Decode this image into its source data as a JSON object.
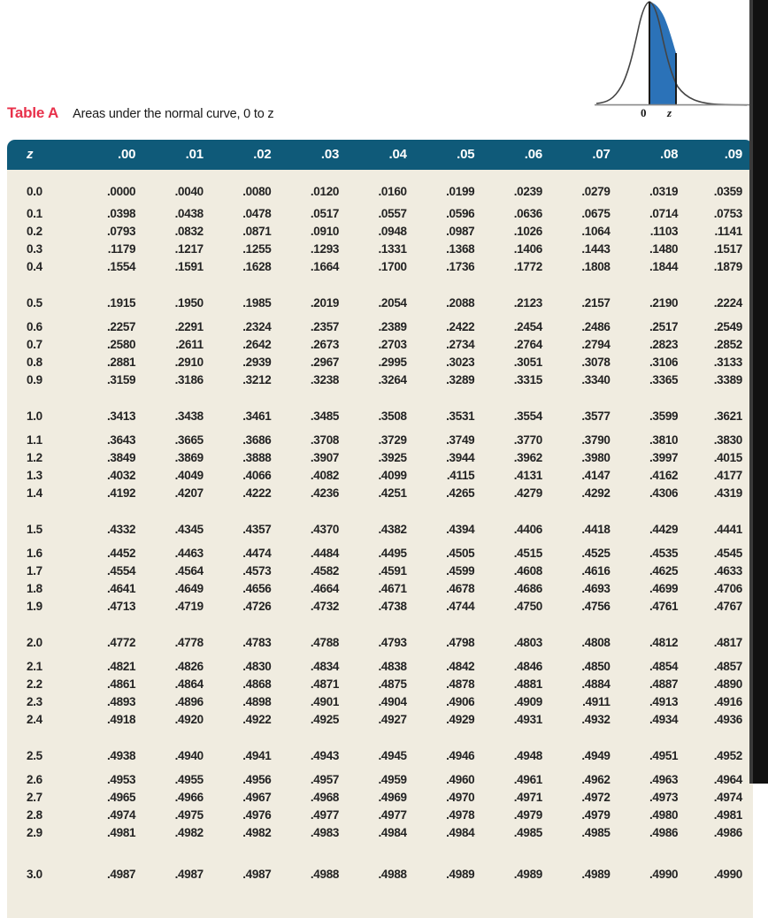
{
  "caption": {
    "label": "Table A",
    "text": "Areas under the normal curve, 0 to z"
  },
  "figure": {
    "name": "normal-curve-diagram",
    "axis_label_zero": "0",
    "axis_label_z": "z",
    "shade_color": "#2b72b8",
    "curve_color": "#444444"
  },
  "colors": {
    "header_background": "#0f5a79",
    "header_text": "#ffffff",
    "body_background": "#f0ece0",
    "body_text": "#232323",
    "caption_accent": "#e8304a",
    "page_background": "#ffffff",
    "page_edge": "#111111"
  },
  "table": {
    "columns": [
      "z",
      ".00",
      ".01",
      ".02",
      ".03",
      ".04",
      ".05",
      ".06",
      ".07",
      ".08",
      ".09"
    ],
    "group_size": 5,
    "rows": [
      [
        "0.0",
        ".0000",
        ".0040",
        ".0080",
        ".0120",
        ".0160",
        ".0199",
        ".0239",
        ".0279",
        ".0319",
        ".0359"
      ],
      [
        "0.1",
        ".0398",
        ".0438",
        ".0478",
        ".0517",
        ".0557",
        ".0596",
        ".0636",
        ".0675",
        ".0714",
        ".0753"
      ],
      [
        "0.2",
        ".0793",
        ".0832",
        ".0871",
        ".0910",
        ".0948",
        ".0987",
        ".1026",
        ".1064",
        ".1103",
        ".1141"
      ],
      [
        "0.3",
        ".1179",
        ".1217",
        ".1255",
        ".1293",
        ".1331",
        ".1368",
        ".1406",
        ".1443",
        ".1480",
        ".1517"
      ],
      [
        "0.4",
        ".1554",
        ".1591",
        ".1628",
        ".1664",
        ".1700",
        ".1736",
        ".1772",
        ".1808",
        ".1844",
        ".1879"
      ],
      [
        "0.5",
        ".1915",
        ".1950",
        ".1985",
        ".2019",
        ".2054",
        ".2088",
        ".2123",
        ".2157",
        ".2190",
        ".2224"
      ],
      [
        "0.6",
        ".2257",
        ".2291",
        ".2324",
        ".2357",
        ".2389",
        ".2422",
        ".2454",
        ".2486",
        ".2517",
        ".2549"
      ],
      [
        "0.7",
        ".2580",
        ".2611",
        ".2642",
        ".2673",
        ".2703",
        ".2734",
        ".2764",
        ".2794",
        ".2823",
        ".2852"
      ],
      [
        "0.8",
        ".2881",
        ".2910",
        ".2939",
        ".2967",
        ".2995",
        ".3023",
        ".3051",
        ".3078",
        ".3106",
        ".3133"
      ],
      [
        "0.9",
        ".3159",
        ".3186",
        ".3212",
        ".3238",
        ".3264",
        ".3289",
        ".3315",
        ".3340",
        ".3365",
        ".3389"
      ],
      [
        "1.0",
        ".3413",
        ".3438",
        ".3461",
        ".3485",
        ".3508",
        ".3531",
        ".3554",
        ".3577",
        ".3599",
        ".3621"
      ],
      [
        "1.1",
        ".3643",
        ".3665",
        ".3686",
        ".3708",
        ".3729",
        ".3749",
        ".3770",
        ".3790",
        ".3810",
        ".3830"
      ],
      [
        "1.2",
        ".3849",
        ".3869",
        ".3888",
        ".3907",
        ".3925",
        ".3944",
        ".3962",
        ".3980",
        ".3997",
        ".4015"
      ],
      [
        "1.3",
        ".4032",
        ".4049",
        ".4066",
        ".4082",
        ".4099",
        ".4115",
        ".4131",
        ".4147",
        ".4162",
        ".4177"
      ],
      [
        "1.4",
        ".4192",
        ".4207",
        ".4222",
        ".4236",
        ".4251",
        ".4265",
        ".4279",
        ".4292",
        ".4306",
        ".4319"
      ],
      [
        "1.5",
        ".4332",
        ".4345",
        ".4357",
        ".4370",
        ".4382",
        ".4394",
        ".4406",
        ".4418",
        ".4429",
        ".4441"
      ],
      [
        "1.6",
        ".4452",
        ".4463",
        ".4474",
        ".4484",
        ".4495",
        ".4505",
        ".4515",
        ".4525",
        ".4535",
        ".4545"
      ],
      [
        "1.7",
        ".4554",
        ".4564",
        ".4573",
        ".4582",
        ".4591",
        ".4599",
        ".4608",
        ".4616",
        ".4625",
        ".4633"
      ],
      [
        "1.8",
        ".4641",
        ".4649",
        ".4656",
        ".4664",
        ".4671",
        ".4678",
        ".4686",
        ".4693",
        ".4699",
        ".4706"
      ],
      [
        "1.9",
        ".4713",
        ".4719",
        ".4726",
        ".4732",
        ".4738",
        ".4744",
        ".4750",
        ".4756",
        ".4761",
        ".4767"
      ],
      [
        "2.0",
        ".4772",
        ".4778",
        ".4783",
        ".4788",
        ".4793",
        ".4798",
        ".4803",
        ".4808",
        ".4812",
        ".4817"
      ],
      [
        "2.1",
        ".4821",
        ".4826",
        ".4830",
        ".4834",
        ".4838",
        ".4842",
        ".4846",
        ".4850",
        ".4854",
        ".4857"
      ],
      [
        "2.2",
        ".4861",
        ".4864",
        ".4868",
        ".4871",
        ".4875",
        ".4878",
        ".4881",
        ".4884",
        ".4887",
        ".4890"
      ],
      [
        "2.3",
        ".4893",
        ".4896",
        ".4898",
        ".4901",
        ".4904",
        ".4906",
        ".4909",
        ".4911",
        ".4913",
        ".4916"
      ],
      [
        "2.4",
        ".4918",
        ".4920",
        ".4922",
        ".4925",
        ".4927",
        ".4929",
        ".4931",
        ".4932",
        ".4934",
        ".4936"
      ],
      [
        "2.5",
        ".4938",
        ".4940",
        ".4941",
        ".4943",
        ".4945",
        ".4946",
        ".4948",
        ".4949",
        ".4951",
        ".4952"
      ],
      [
        "2.6",
        ".4953",
        ".4955",
        ".4956",
        ".4957",
        ".4959",
        ".4960",
        ".4961",
        ".4962",
        ".4963",
        ".4964"
      ],
      [
        "2.7",
        ".4965",
        ".4966",
        ".4967",
        ".4968",
        ".4969",
        ".4970",
        ".4971",
        ".4972",
        ".4973",
        ".4974"
      ],
      [
        "2.8",
        ".4974",
        ".4975",
        ".4976",
        ".4977",
        ".4977",
        ".4978",
        ".4979",
        ".4979",
        ".4980",
        ".4981"
      ],
      [
        "2.9",
        ".4981",
        ".4982",
        ".4982",
        ".4983",
        ".4984",
        ".4984",
        ".4985",
        ".4985",
        ".4986",
        ".4986"
      ],
      [
        "3.0",
        ".4987",
        ".4987",
        ".4987",
        ".4988",
        ".4988",
        ".4989",
        ".4989",
        ".4989",
        ".4990",
        ".4990"
      ]
    ]
  },
  "chart_data": {
    "type": "table",
    "title": "Areas under the normal curve, 0 to z",
    "xlabel": "z",
    "ylabel": "Area",
    "description": "Standard normal cumulative area from 0 to z",
    "row_index": [
      "0.0",
      "0.1",
      "0.2",
      "0.3",
      "0.4",
      "0.5",
      "0.6",
      "0.7",
      "0.8",
      "0.9",
      "1.0",
      "1.1",
      "1.2",
      "1.3",
      "1.4",
      "1.5",
      "1.6",
      "1.7",
      "1.8",
      "1.9",
      "2.0",
      "2.1",
      "2.2",
      "2.3",
      "2.4",
      "2.5",
      "2.6",
      "2.7",
      "2.8",
      "2.9",
      "3.0"
    ],
    "column_offsets": [
      ".00",
      ".01",
      ".02",
      ".03",
      ".04",
      ".05",
      ".06",
      ".07",
      ".08",
      ".09"
    ],
    "values": [
      [
        0.0,
        0.004,
        0.008,
        0.012,
        0.016,
        0.0199,
        0.0239,
        0.0279,
        0.0319,
        0.0359
      ],
      [
        0.0398,
        0.0438,
        0.0478,
        0.0517,
        0.0557,
        0.0596,
        0.0636,
        0.0675,
        0.0714,
        0.0753
      ],
      [
        0.0793,
        0.0832,
        0.0871,
        0.091,
        0.0948,
        0.0987,
        0.1026,
        0.1064,
        0.1103,
        0.1141
      ],
      [
        0.1179,
        0.1217,
        0.1255,
        0.1293,
        0.1331,
        0.1368,
        0.1406,
        0.1443,
        0.148,
        0.1517
      ],
      [
        0.1554,
        0.1591,
        0.1628,
        0.1664,
        0.17,
        0.1736,
        0.1772,
        0.1808,
        0.1844,
        0.1879
      ],
      [
        0.1915,
        0.195,
        0.1985,
        0.2019,
        0.2054,
        0.2088,
        0.2123,
        0.2157,
        0.219,
        0.2224
      ],
      [
        0.2257,
        0.2291,
        0.2324,
        0.2357,
        0.2389,
        0.2422,
        0.2454,
        0.2486,
        0.2517,
        0.2549
      ],
      [
        0.258,
        0.2611,
        0.2642,
        0.2673,
        0.2703,
        0.2734,
        0.2764,
        0.2794,
        0.2823,
        0.2852
      ],
      [
        0.2881,
        0.291,
        0.2939,
        0.2967,
        0.2995,
        0.3023,
        0.3051,
        0.3078,
        0.3106,
        0.3133
      ],
      [
        0.3159,
        0.3186,
        0.3212,
        0.3238,
        0.3264,
        0.3289,
        0.3315,
        0.334,
        0.3365,
        0.3389
      ],
      [
        0.3413,
        0.3438,
        0.3461,
        0.3485,
        0.3508,
        0.3531,
        0.3554,
        0.3577,
        0.3599,
        0.3621
      ],
      [
        0.3643,
        0.3665,
        0.3686,
        0.3708,
        0.3729,
        0.3749,
        0.377,
        0.379,
        0.381,
        0.383
      ],
      [
        0.3849,
        0.3869,
        0.3888,
        0.3907,
        0.3925,
        0.3944,
        0.3962,
        0.398,
        0.3997,
        0.4015
      ],
      [
        0.4032,
        0.4049,
        0.4066,
        0.4082,
        0.4099,
        0.4115,
        0.4131,
        0.4147,
        0.4162,
        0.4177
      ],
      [
        0.4192,
        0.4207,
        0.4222,
        0.4236,
        0.4251,
        0.4265,
        0.4279,
        0.4292,
        0.4306,
        0.4319
      ],
      [
        0.4332,
        0.4345,
        0.4357,
        0.437,
        0.4382,
        0.4394,
        0.4406,
        0.4418,
        0.4429,
        0.4441
      ],
      [
        0.4452,
        0.4463,
        0.4474,
        0.4484,
        0.4495,
        0.4505,
        0.4515,
        0.4525,
        0.4535,
        0.4545
      ],
      [
        0.4554,
        0.4564,
        0.4573,
        0.4582,
        0.4591,
        0.4599,
        0.4608,
        0.4616,
        0.4625,
        0.4633
      ],
      [
        0.4641,
        0.4649,
        0.4656,
        0.4664,
        0.4671,
        0.4678,
        0.4686,
        0.4693,
        0.4699,
        0.4706
      ],
      [
        0.4713,
        0.4719,
        0.4726,
        0.4732,
        0.4738,
        0.4744,
        0.475,
        0.4756,
        0.4761,
        0.4767
      ],
      [
        0.4772,
        0.4778,
        0.4783,
        0.4788,
        0.4793,
        0.4798,
        0.4803,
        0.4808,
        0.4812,
        0.4817
      ],
      [
        0.4821,
        0.4826,
        0.483,
        0.4834,
        0.4838,
        0.4842,
        0.4846,
        0.485,
        0.4854,
        0.4857
      ],
      [
        0.4861,
        0.4864,
        0.4868,
        0.4871,
        0.4875,
        0.4878,
        0.4881,
        0.4884,
        0.4887,
        0.489
      ],
      [
        0.4893,
        0.4896,
        0.4898,
        0.4901,
        0.4904,
        0.4906,
        0.4909,
        0.4911,
        0.4913,
        0.4916
      ],
      [
        0.4918,
        0.492,
        0.4922,
        0.4925,
        0.4927,
        0.4929,
        0.4931,
        0.4932,
        0.4934,
        0.4936
      ],
      [
        0.4938,
        0.494,
        0.4941,
        0.4943,
        0.4945,
        0.4946,
        0.4948,
        0.4949,
        0.4951,
        0.4952
      ],
      [
        0.4953,
        0.4955,
        0.4956,
        0.4957,
        0.4959,
        0.496,
        0.4961,
        0.4962,
        0.4963,
        0.4964
      ],
      [
        0.4965,
        0.4966,
        0.4967,
        0.4968,
        0.4969,
        0.497,
        0.4971,
        0.4972,
        0.4973,
        0.4974
      ],
      [
        0.4974,
        0.4975,
        0.4976,
        0.4977,
        0.4977,
        0.4978,
        0.4979,
        0.4979,
        0.498,
        0.4981
      ],
      [
        0.4981,
        0.4982,
        0.4982,
        0.4983,
        0.4984,
        0.4984,
        0.4985,
        0.4985,
        0.4986,
        0.4986
      ],
      [
        0.4987,
        0.4987,
        0.4987,
        0.4988,
        0.4988,
        0.4989,
        0.4989,
        0.4989,
        0.499,
        0.499
      ]
    ]
  }
}
